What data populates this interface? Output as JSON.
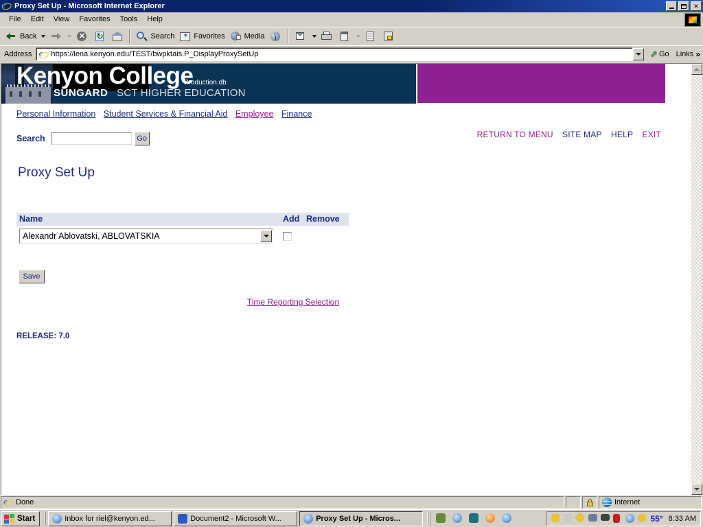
{
  "window": {
    "title": "Proxy Set Up - Microsoft Internet Explorer",
    "icon": "ie-logo-icon",
    "minimize_label": "Minimize",
    "restore_label": "Restore",
    "close_label": "✕"
  },
  "menubar": {
    "items": [
      {
        "label": "File"
      },
      {
        "label": "Edit"
      },
      {
        "label": "View"
      },
      {
        "label": "Favorites"
      },
      {
        "label": "Tools"
      },
      {
        "label": "Help"
      }
    ]
  },
  "toolbar": {
    "back_label": "Back",
    "search_label": "Search",
    "favorites_label": "Favorites",
    "media_label": "Media",
    "icons": [
      "back-icon",
      "forward-icon",
      "stop-icon",
      "refresh-icon",
      "home-icon",
      "search-icon",
      "favorites-icon",
      "media-icon",
      "history-icon",
      "mail-icon",
      "print-icon",
      "edit-icon",
      "discuss-icon",
      "messenger-icon"
    ]
  },
  "address_bar": {
    "label": "Address",
    "url": "https://lena.kenyon.edu/TEST/bwpktais.P_DisplayProxySetUp",
    "go_label": "Go",
    "links_label": "Links",
    "chevron": "»"
  },
  "page": {
    "banner": {
      "college": "Kenyon College",
      "database": "Production.db",
      "vendor_bold": "SUNGARD",
      "vendor_rest": "SCT HIGHER EDUCATION",
      "navy_color": "#0b3355",
      "magenta_color": "#8e2292"
    },
    "nav_links": [
      {
        "label": "Personal Information",
        "visited": false
      },
      {
        "label": "Student Services & Financial Aid",
        "visited": false
      },
      {
        "label": "Employee",
        "visited": true
      },
      {
        "label": "Finance",
        "visited": false
      }
    ],
    "search": {
      "label": "Search",
      "value": "",
      "placeholder": "",
      "go_label": "Go"
    },
    "header_links": [
      {
        "label": "RETURN TO MENU",
        "visited": true
      },
      {
        "label": "SITE MAP",
        "visited": false
      },
      {
        "label": "HELP",
        "visited": false
      },
      {
        "label": "EXIT",
        "visited": true
      }
    ],
    "heading": "Proxy Set Up",
    "table": {
      "columns": [
        "Name",
        "Add",
        "Remove"
      ],
      "rows": [
        {
          "name": "Alexandr Ablovatski, ABLOVATSKIA",
          "add_checked": false,
          "remove_checked": null
        }
      ]
    },
    "save_label": "Save",
    "time_reporting_link": "Time Reporting Selection",
    "release": "RELEASE: 7.0",
    "link_color": "#1a2d7a",
    "visited_link_color": "#9c1b91"
  },
  "statusbar": {
    "status_text": "Done",
    "zone_text": "Internet",
    "lock_icon": "security-lock-icon"
  },
  "taskbar": {
    "start_label": "Start",
    "buttons": [
      {
        "label": "Inbox for riel@kenyon.ed...",
        "active": false,
        "icon": "outlook-icon"
      },
      {
        "label": "Document2 - Microsoft W...",
        "active": false,
        "icon": "word-icon"
      },
      {
        "label": "Proxy Set Up - Micros...",
        "active": true,
        "icon": "ie-logo-icon"
      }
    ],
    "quick_launch": [
      "show-desktop-icon",
      "ie-icon",
      "network-icon",
      "firefox-icon",
      "outlook-icon"
    ],
    "tray_icons": [
      "power-icon",
      "volume-icon",
      "pen-icon",
      "printer-icon",
      "camera-icon",
      "info-icon",
      "network-icon",
      "update-icon"
    ],
    "temperature": "55°",
    "clock": "8:33 AM"
  }
}
